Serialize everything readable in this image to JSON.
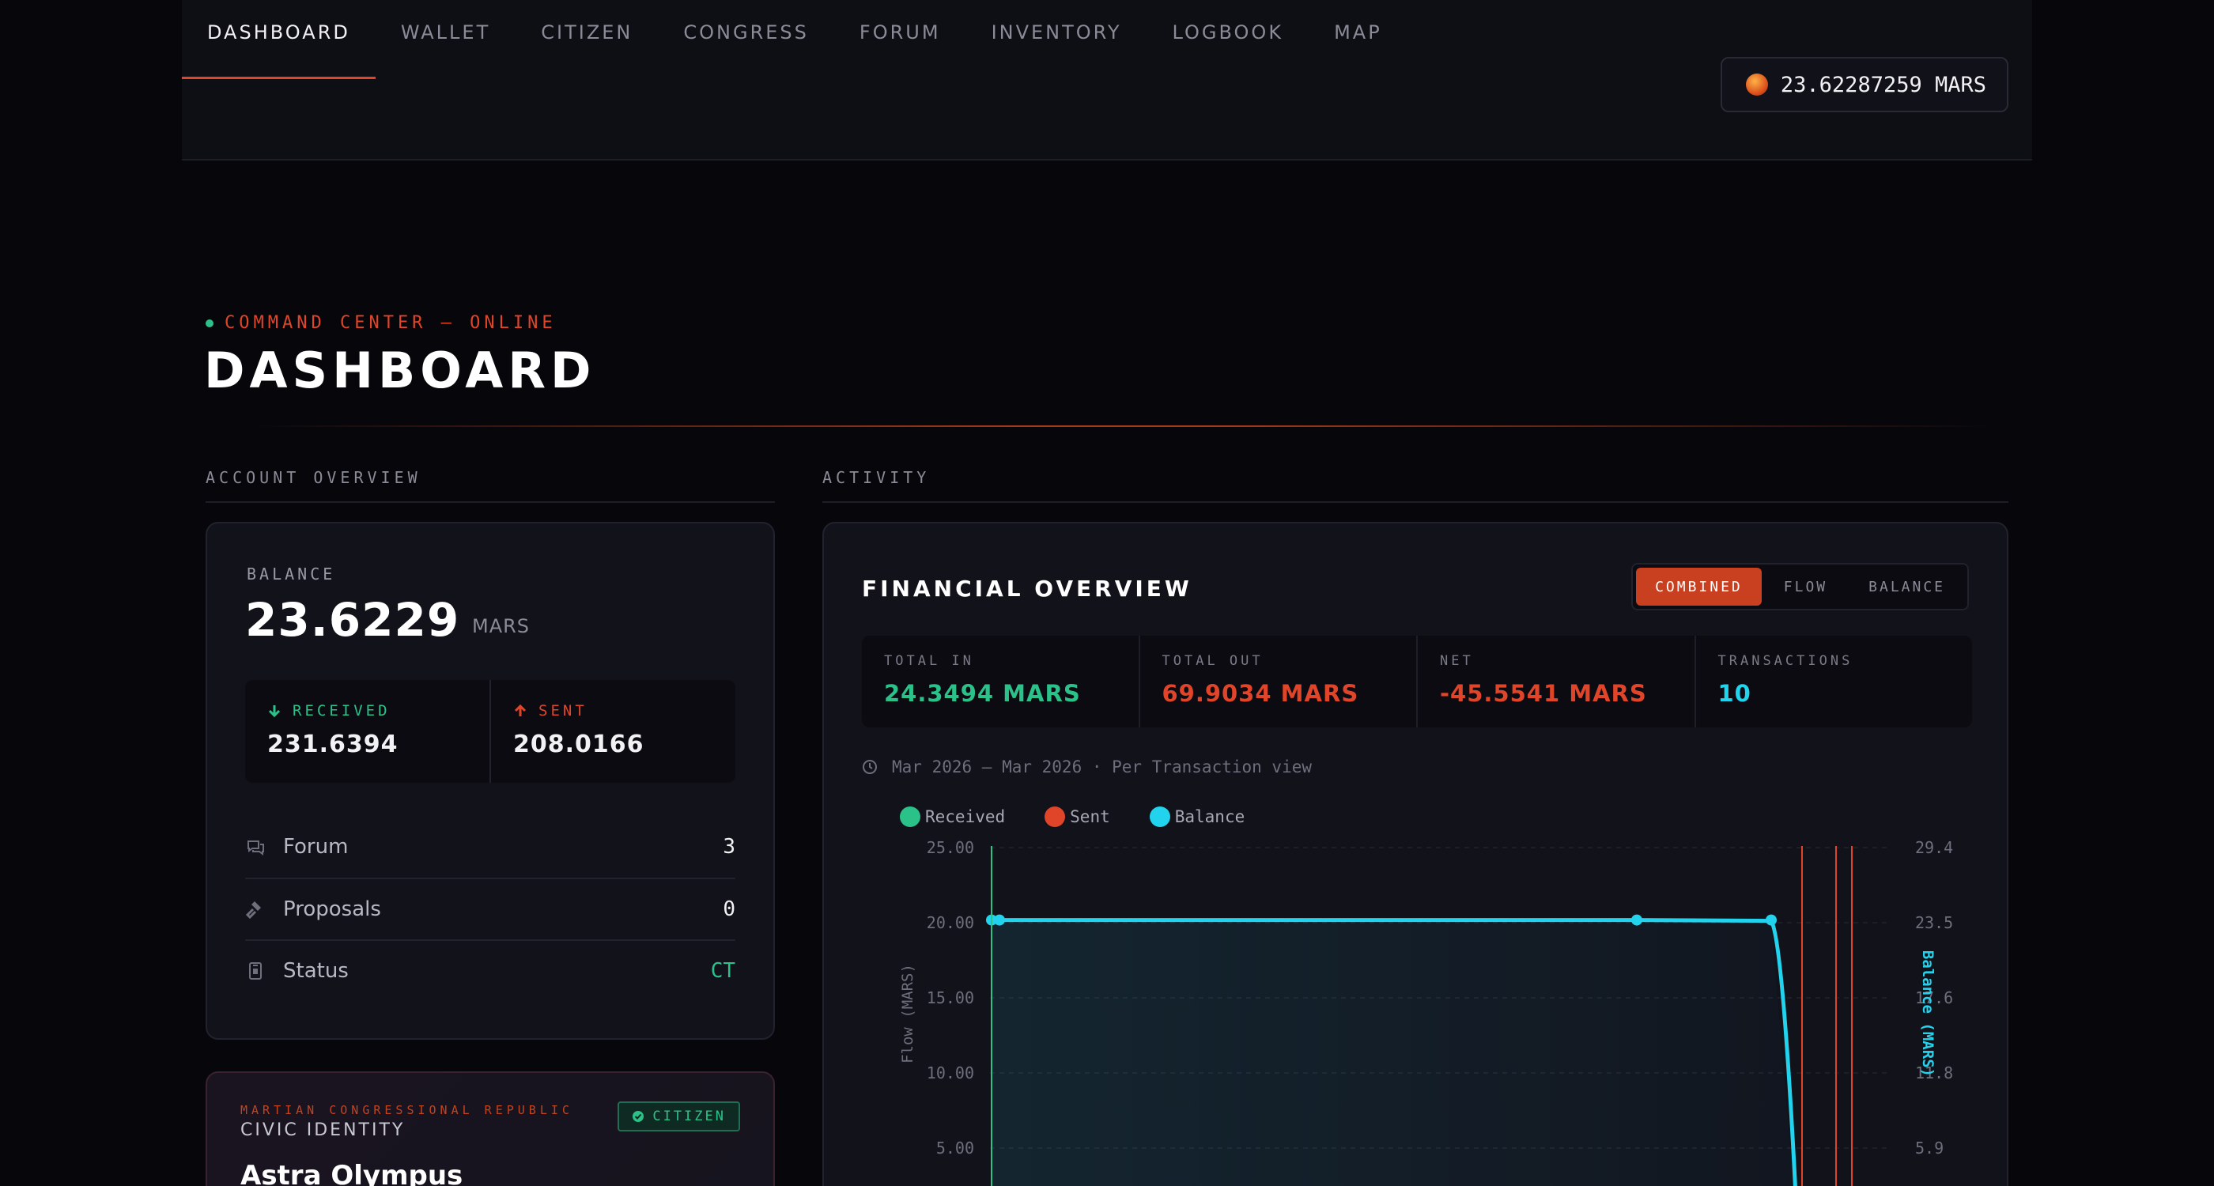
{
  "nav": {
    "items": [
      "DASHBOARD",
      "WALLET",
      "CITIZEN",
      "CONGRESS",
      "FORUM",
      "INVENTORY",
      "LOGBOOK",
      "MAP"
    ],
    "active": "DASHBOARD",
    "balance_pill": "23.62287259 MARS"
  },
  "header": {
    "status": "COMMAND CENTER — ONLINE",
    "title": "DASHBOARD"
  },
  "sections": {
    "account": "ACCOUNT OVERVIEW",
    "activity": "ACTIVITY"
  },
  "account": {
    "balance_label": "BALANCE",
    "balance_value": "23.6229",
    "balance_unit": "MARS",
    "received_label": "RECEIVED",
    "received_value": "231.6394",
    "sent_label": "SENT",
    "sent_value": "208.0166",
    "stats": [
      {
        "label": "Forum",
        "value": "3",
        "icon": "chat-icon"
      },
      {
        "label": "Proposals",
        "value": "0",
        "icon": "gavel-icon"
      },
      {
        "label": "Status",
        "value": "CT",
        "icon": "id-badge-icon"
      }
    ]
  },
  "civic": {
    "tag": "MARTIAN CONGRESSIONAL REPUBLIC",
    "title": "CIVIC IDENTITY",
    "name": "Astra Olympus",
    "badge": "CITIZEN"
  },
  "financial": {
    "title": "FINANCIAL OVERVIEW",
    "modes": [
      "COMBINED",
      "FLOW",
      "BALANCE"
    ],
    "active_mode": "COMBINED",
    "kpis": [
      {
        "label": "TOTAL IN",
        "value": "24.3494 MARS",
        "tone": "green"
      },
      {
        "label": "TOTAL OUT",
        "value": "69.9034 MARS",
        "tone": "red"
      },
      {
        "label": "NET",
        "value": "-45.5541 MARS",
        "tone": "red"
      },
      {
        "label": "TRANSACTIONS",
        "value": "10",
        "tone": "cyan"
      }
    ],
    "range": "Mar 2026 — Mar 2026 · Per Transaction view"
  },
  "colors": {
    "accent": "#e0452a",
    "received": "#2bc28a",
    "sent": "#e0452a",
    "balance": "#22d3ee"
  },
  "chart_data": {
    "type": "line",
    "legend": [
      "Received",
      "Sent",
      "Balance"
    ],
    "ylabel": "Flow (MARS)",
    "ylabel_right": "Balance (MARS)",
    "y_ticks": [
      "25.00",
      "20.00",
      "15.00",
      "10.00",
      "5.00"
    ],
    "ylim": [
      0,
      25
    ],
    "y2_ticks": [
      "29.4",
      "23.5",
      "17.6",
      "11.8",
      "5.9"
    ],
    "y2lim": [
      0,
      29.4
    ],
    "series": [
      {
        "name": "Balance",
        "x": [
          0,
          0.01,
          0.8,
          0.97,
          1.0
        ],
        "values": [
          24.0,
          24.0,
          24.0,
          23.9,
          0
        ]
      }
    ],
    "received_spikes_x": [
      0
    ],
    "sent_spikes_x": [
      1.0,
      1.04,
      1.06
    ],
    "grid": true
  }
}
